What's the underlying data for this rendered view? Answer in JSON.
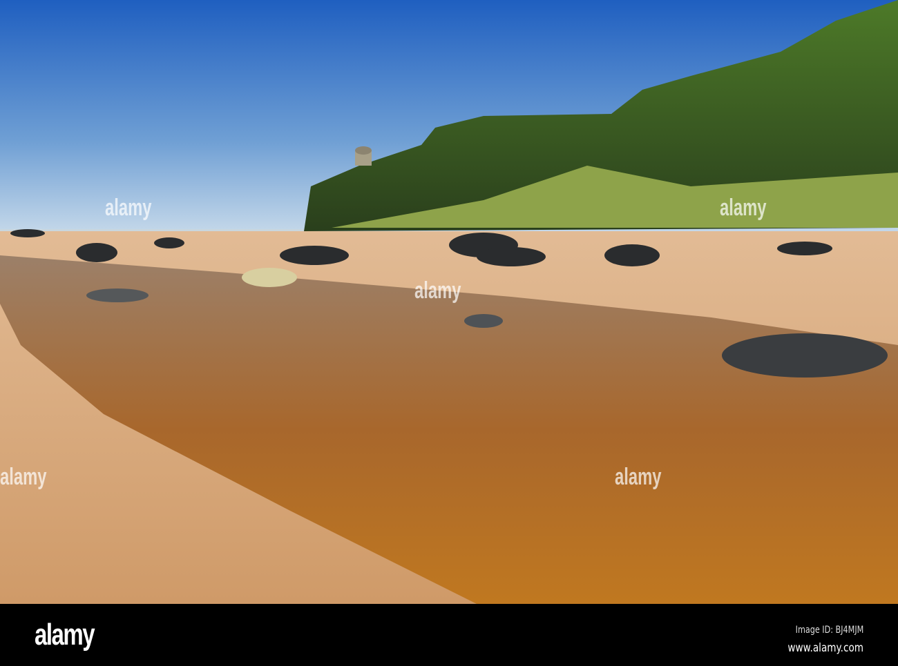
{
  "photo": {
    "subject": "Beach with stream, dark rocks and green cliffs with domed temple under blue sky",
    "colors": {
      "sky_top": "#1f5fc0",
      "sky_bottom": "#b8d0e6",
      "cliff": "#3f6a22",
      "sand": "#d7a87a",
      "water": "#a8672c"
    }
  },
  "watermark": {
    "text": "alamy"
  },
  "footer": {
    "logo": "alamy",
    "image_id": "Image ID: BJ4MJM",
    "website": "www.alamy.com"
  }
}
